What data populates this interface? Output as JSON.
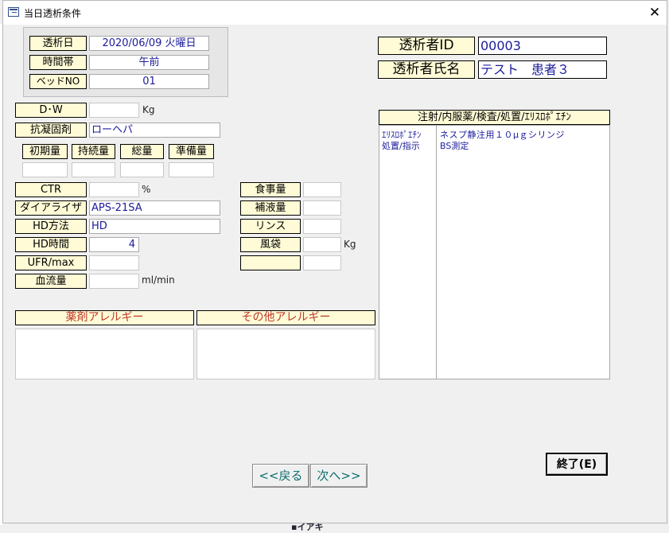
{
  "window": {
    "title": "当日透析条件",
    "close_glyph": "✕"
  },
  "top": {
    "dialysis_day_label": "透析日",
    "dialysis_day_value": "2020/06/09 火曜日",
    "time_label": "時間帯",
    "time_value": "午前",
    "bed_label": "ベッドNO",
    "bed_value": "01"
  },
  "patient": {
    "id_label": "透析者ID",
    "id_value": "00003",
    "name_label": "透析者氏名",
    "name_value": "テスト　患者３"
  },
  "left": {
    "dw_label": "D･W",
    "dw_value": "",
    "dw_unit": "Kg",
    "anticoag_label": "抗凝固剤",
    "anticoag_value": "ローヘパ",
    "dose_headers": [
      "初期量",
      "持続量",
      "総量",
      "準備量"
    ],
    "ctr_label": "CTR",
    "ctr_value": "",
    "ctr_unit": "%",
    "dializer_label": "ダイアライザ",
    "dializer_value": "APS-21SA",
    "hd_method_label": "HD方法",
    "hd_method_value": "HD",
    "hd_time_label": "HD時間",
    "hd_time_value": "4",
    "ufr_label": "UFR/max",
    "ufr_value": "",
    "blood_flow_label": "血流量",
    "blood_flow_value": "",
    "blood_flow_unit": "ml/min"
  },
  "middle": {
    "meal_label": "食事量",
    "fluid_label": "補液量",
    "rinse_label": "リンス",
    "wind_label": "風袋",
    "wind_unit": "Kg",
    "extra_label": ""
  },
  "allergy": {
    "drug_label": "薬剤アレルギー",
    "other_label": "その他アレルギー",
    "drug_text": "",
    "other_text": ""
  },
  "orders": {
    "header": "注射/内服薬/検査/処置/ｴﾘｽﾛﾎﾟｴﾁﾝ",
    "col1": [
      "ｴﾘｽﾛﾎﾟｴﾁﾝ",
      "処置/指示"
    ],
    "col2": [
      "ネスプ静注用１０μｇシリンジ",
      "BS測定"
    ]
  },
  "buttons": {
    "back": "<<戻る",
    "next": "次へ>>",
    "end": "終了(E)"
  },
  "colors": {
    "label_bg": "#fffbd6",
    "value_text": "#1b1b9a",
    "allergy_text": "#c0392b",
    "nav_text": "#0c6e6e"
  },
  "background_fragment": "▪イアキ"
}
